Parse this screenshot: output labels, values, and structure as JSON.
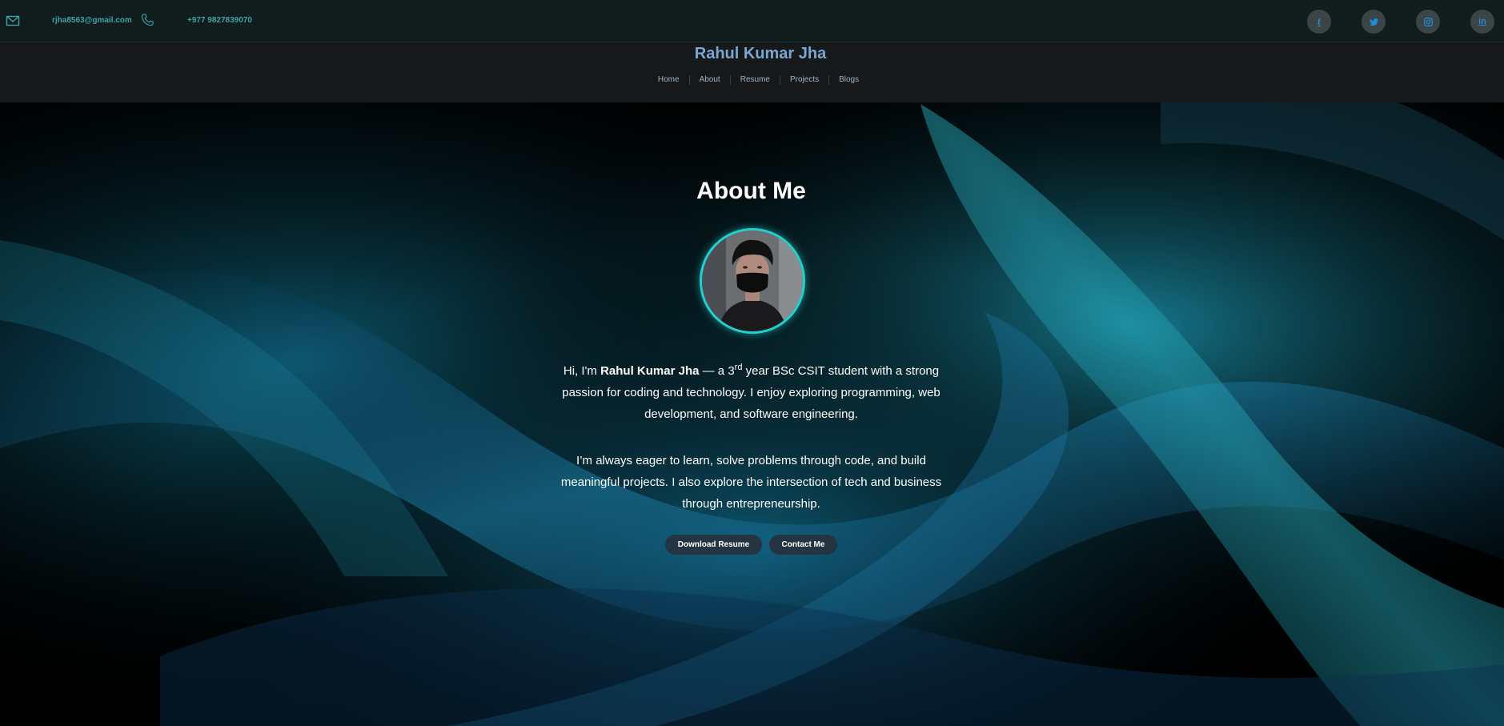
{
  "contact": {
    "email": "rjha8563@gmail.com",
    "phone": "+977 9827839070",
    "email_icon": "mail-icon",
    "phone_icon": "phone-icon"
  },
  "social": [
    {
      "name": "facebook",
      "icon": "facebook-icon",
      "glyph": "f"
    },
    {
      "name": "twitter",
      "icon": "twitter-icon"
    },
    {
      "name": "instagram",
      "icon": "instagram-icon"
    },
    {
      "name": "linkedin",
      "icon": "linkedin-icon",
      "glyph": "in"
    }
  ],
  "header": {
    "brand": "Rahul Kumar Jha",
    "nav": [
      "Home",
      "About",
      "Resume",
      "Projects",
      "Blogs"
    ]
  },
  "about": {
    "title": "About Me",
    "bio1_prefix": "Hi, I'm ",
    "bio1_name": "Rahul Kumar Jha",
    "bio1_mid": " — a 3",
    "bio1_sup": "rd",
    "bio1_rest": " year BSc CSIT student with a strong passion for coding and technology. I enjoy exploring programming, web development, and software engineering.",
    "bio2": "I’m always eager to learn, solve problems through code, and build meaningful projects. I also explore the intersection of tech and business through entrepreneurship.",
    "download_button": "Download Resume",
    "contact_button": "Contact Me"
  },
  "colors": {
    "accent": "#21d0cf",
    "brand": "#79a7d3",
    "contact_text": "#3fa3a6",
    "social_icon": "#1d8fd6",
    "button_bg": "#243441"
  }
}
